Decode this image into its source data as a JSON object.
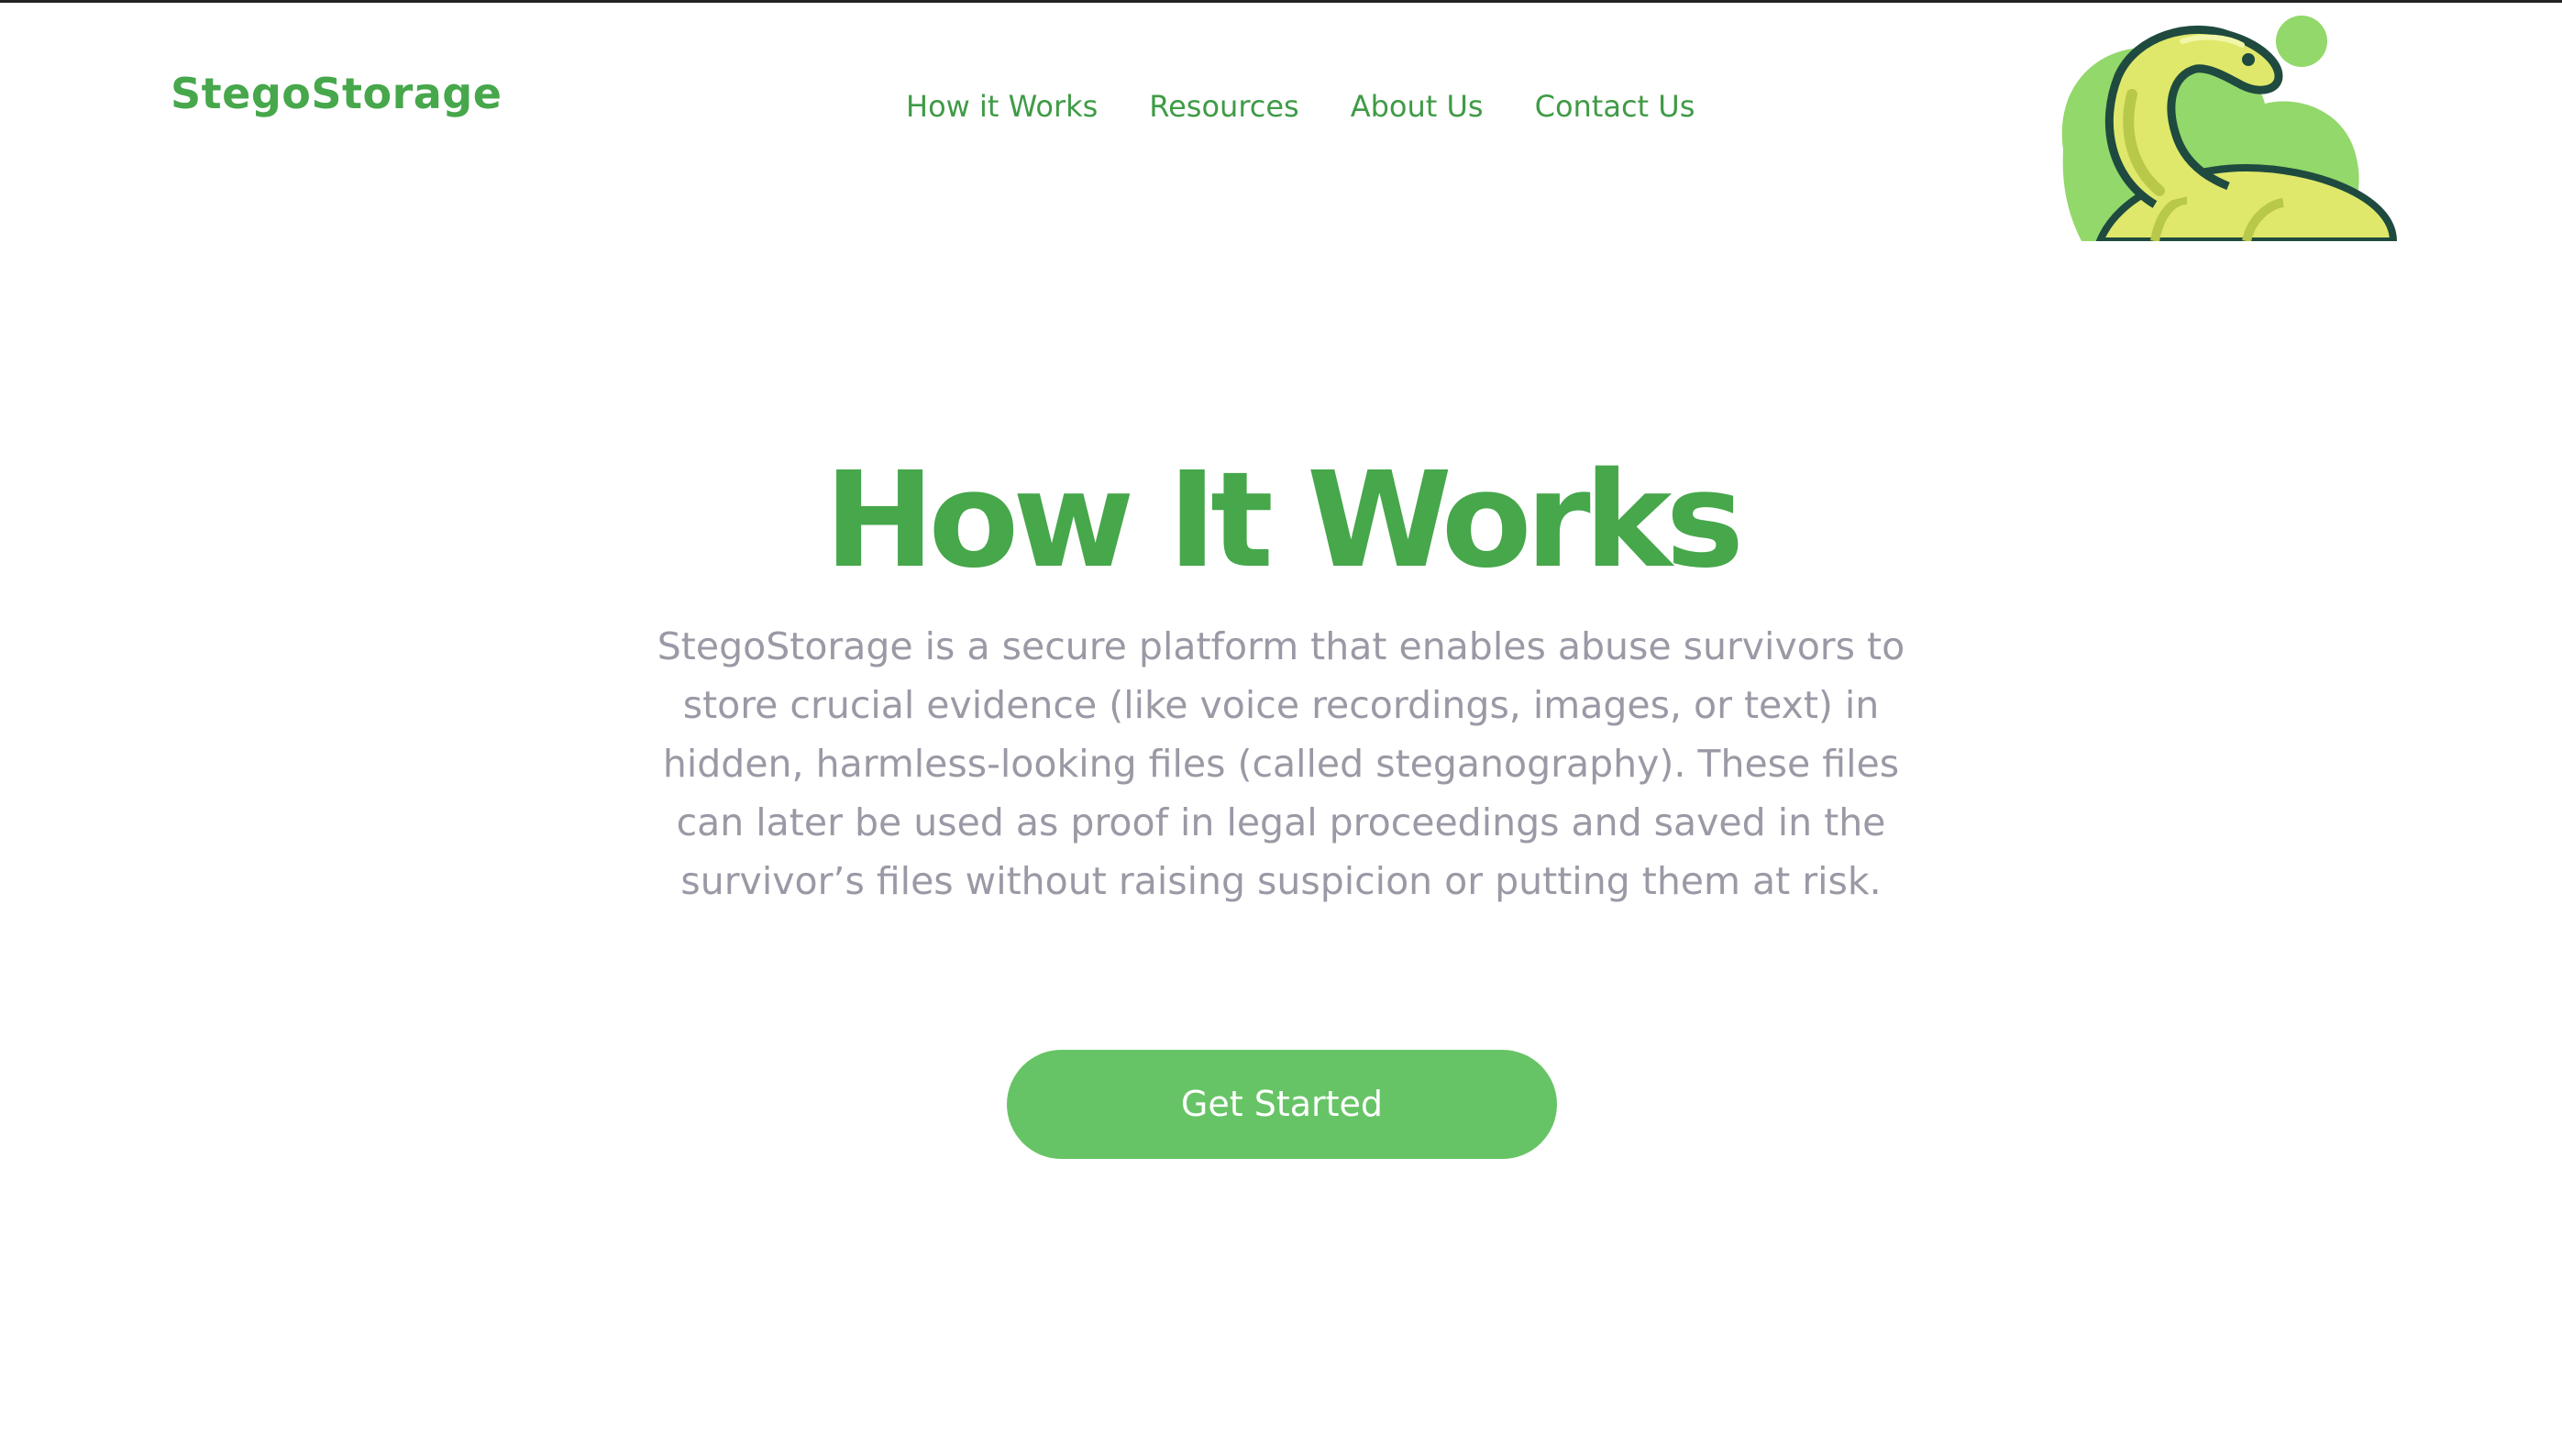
{
  "header": {
    "brand": "StegoStorage",
    "nav": [
      {
        "label": "How it Works"
      },
      {
        "label": "Resources"
      },
      {
        "label": "About Us"
      },
      {
        "label": "Contact Us"
      }
    ]
  },
  "hero": {
    "title": "How It Works",
    "description": "StegoStorage is a secure platform that enables abuse survivors to store crucial evidence (like voice recordings, images, or text) in hidden, harmless-looking files (called steganography). These files can later be used as proof in legal proceedings and saved in the survivor’s files without raising suspicion or putting them at risk.",
    "cta_label": "Get Started"
  },
  "colors": {
    "brand_green": "#46a74b",
    "button_green": "#67c466",
    "text_gray": "#9a99a5",
    "mascot_body": "#dfe86a",
    "mascot_outline": "#1f4a3f",
    "blob_green": "#92d86a"
  },
  "icons": {
    "mascot": "dinosaur-mascot-icon"
  }
}
